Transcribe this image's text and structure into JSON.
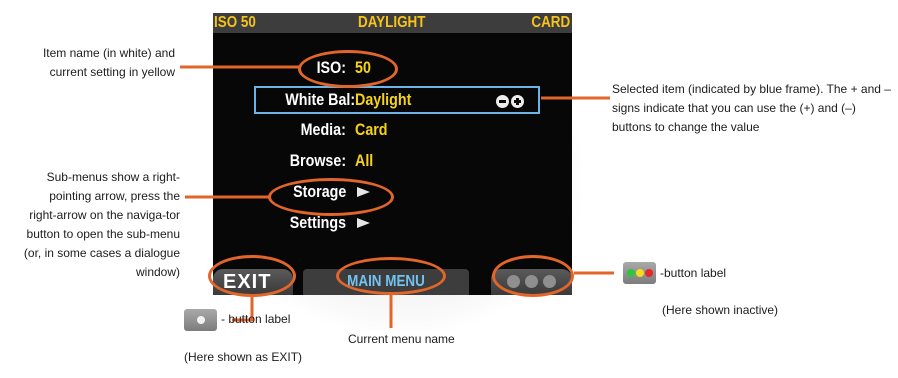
{
  "screen": {
    "top_bar": {
      "iso": "ISO 50",
      "white_balance": "DAYLIGHT",
      "media": "CARD"
    },
    "menu_items": [
      {
        "label": "ISO:",
        "value": "50"
      },
      {
        "label": "White Bal:",
        "value": "Daylight",
        "selected": true
      },
      {
        "label": "Media:",
        "value": "Card"
      },
      {
        "label": "Browse:",
        "value": "All"
      },
      {
        "label": "Storage",
        "submenu": true
      },
      {
        "label": "Settings",
        "submenu": true
      }
    ],
    "bottom_bar": {
      "left_label": "EXIT",
      "menu_name": "MAIN MENU",
      "right_dots": 3
    }
  },
  "annotations": {
    "item_name": "Item name (in white) and current setting in yellow",
    "selected_item": "Selected item (indicated by blue frame). The + and – signs indicate that you can use the (+) and (–) buttons to change the value",
    "submenus": "Sub-menus show a right-pointing arrow, press the right-arrow on the naviga-tor button to open the sub-menu (or, in some cases a dialogue window)",
    "right_button_label": "-button label",
    "right_button_note": "(Here shown inactive)",
    "left_button_label": "- button label",
    "left_button_note": "(Here shown as EXIT)",
    "current_menu": "Current menu name"
  },
  "colors": {
    "accent_orange": "#e2652a",
    "value_yellow": "#f6d21a",
    "selection_blue": "#6db4e6",
    "menu_name_blue": "#72c3f2",
    "dot_green": "#2ec63a",
    "dot_yellow": "#f3dd1f",
    "dot_red": "#e8262b"
  },
  "icons": [
    "plus-minus-icons",
    "right-arrow-icon",
    "gray-button-icon",
    "color-dots-button-icon"
  ]
}
